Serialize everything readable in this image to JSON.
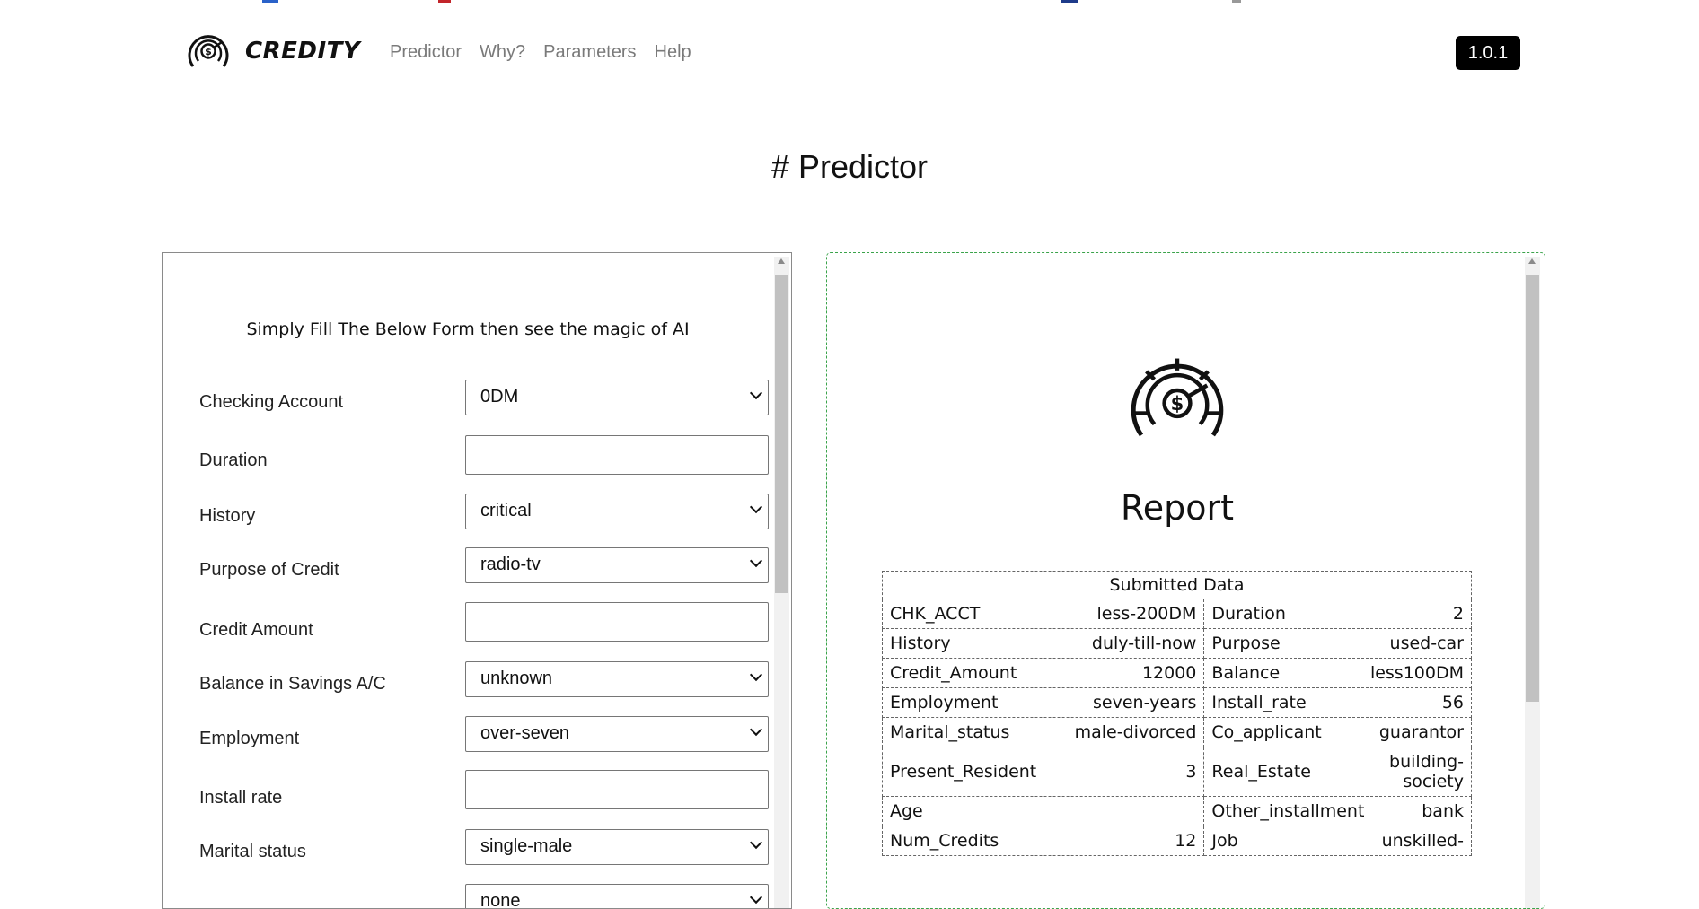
{
  "colors": {
    "accent_border": "#3aa34a",
    "version_bg": "#000000"
  },
  "brand": {
    "name": "CREDITY"
  },
  "nav": {
    "items": [
      "Predictor",
      "Why?",
      "Parameters",
      "Help"
    ]
  },
  "version": "1.0.1",
  "page": {
    "title": "# Predictor"
  },
  "form": {
    "intro": "Simply Fill The Below Form then see the magic of AI",
    "fields": [
      {
        "label": "Checking Account",
        "type": "select",
        "value": "0DM"
      },
      {
        "label": "Duration",
        "type": "input",
        "value": ""
      },
      {
        "label": "History",
        "type": "select",
        "value": "critical"
      },
      {
        "label": "Purpose of Credit",
        "type": "select",
        "value": "radio-tv"
      },
      {
        "label": "Credit Amount",
        "type": "input",
        "value": ""
      },
      {
        "label": "Balance in Savings A/C",
        "type": "select",
        "value": "unknown"
      },
      {
        "label": "Employment",
        "type": "select",
        "value": "over-seven"
      },
      {
        "label": "Install rate",
        "type": "input",
        "value": ""
      },
      {
        "label": "Marital status",
        "type": "select",
        "value": "single-male"
      },
      {
        "label": "",
        "type": "select",
        "value": "none"
      }
    ]
  },
  "report": {
    "title": "Report",
    "table_header": "Submitted Data",
    "rows": [
      [
        [
          "CHK_ACCT",
          "less-200DM"
        ],
        [
          "Duration",
          "2"
        ]
      ],
      [
        [
          "History",
          "duly-till-now"
        ],
        [
          "Purpose",
          "used-car"
        ]
      ],
      [
        [
          "Credit_Amount",
          "12000"
        ],
        [
          "Balance",
          "less100DM"
        ]
      ],
      [
        [
          "Employment",
          "seven-years"
        ],
        [
          "Install_rate",
          "56"
        ]
      ],
      [
        [
          "Marital_status",
          "male-divorced"
        ],
        [
          "Co_applicant",
          "guarantor"
        ]
      ],
      [
        [
          "Present_Resident",
          "3"
        ],
        [
          "Real_Estate",
          "building-society"
        ]
      ],
      [
        [
          "Age",
          ""
        ],
        [
          "Other_installment",
          "bank"
        ]
      ],
      [
        [
          "Num_Credits",
          "12"
        ],
        [
          "Job",
          "unskilled-"
        ]
      ]
    ]
  }
}
